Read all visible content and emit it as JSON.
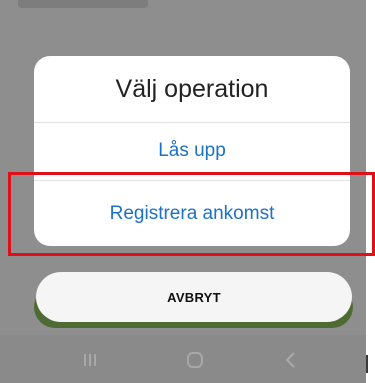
{
  "dialog": {
    "title": "Välj operation",
    "options": [
      {
        "label": "Lås upp"
      },
      {
        "label": "Registrera ankomst"
      }
    ],
    "cancel_label": "AVBRYT"
  },
  "highlight": {
    "color": "#e0101a",
    "target": "Registrera ankomst"
  },
  "colors": {
    "option_text": "#1d72c4",
    "backdrop": "#8e8e8e",
    "accent_green": "#4d6b33"
  },
  "navbar": {
    "icons": [
      "recent-apps-icon",
      "home-icon",
      "back-icon"
    ]
  }
}
